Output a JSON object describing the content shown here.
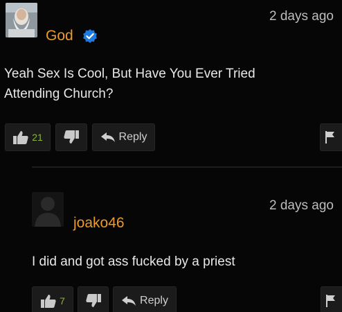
{
  "comments": [
    {
      "username": "God",
      "timestamp": "2 days ago",
      "text": "Yeah Sex Is Cool, But Have You Ever Tried Attending Church?",
      "likes": "21",
      "reply_label": "Reply",
      "verified": true
    },
    {
      "username": "joako46",
      "timestamp": "2 days ago",
      "text": "I did and got ass fucked by a priest",
      "likes": "7",
      "reply_label": "Reply",
      "verified": false
    }
  ],
  "colors": {
    "background": "#060606",
    "username": "#ec9a2a",
    "like_count": "#8ab43a",
    "verified_badge": "#1f7ae0",
    "button": "#1b1b1b"
  },
  "icons": {
    "like": "thumbs-up-icon",
    "dislike": "thumbs-down-icon",
    "reply": "reply-arrow-icon",
    "flag": "flag-icon",
    "verified": "verified-check-icon"
  }
}
